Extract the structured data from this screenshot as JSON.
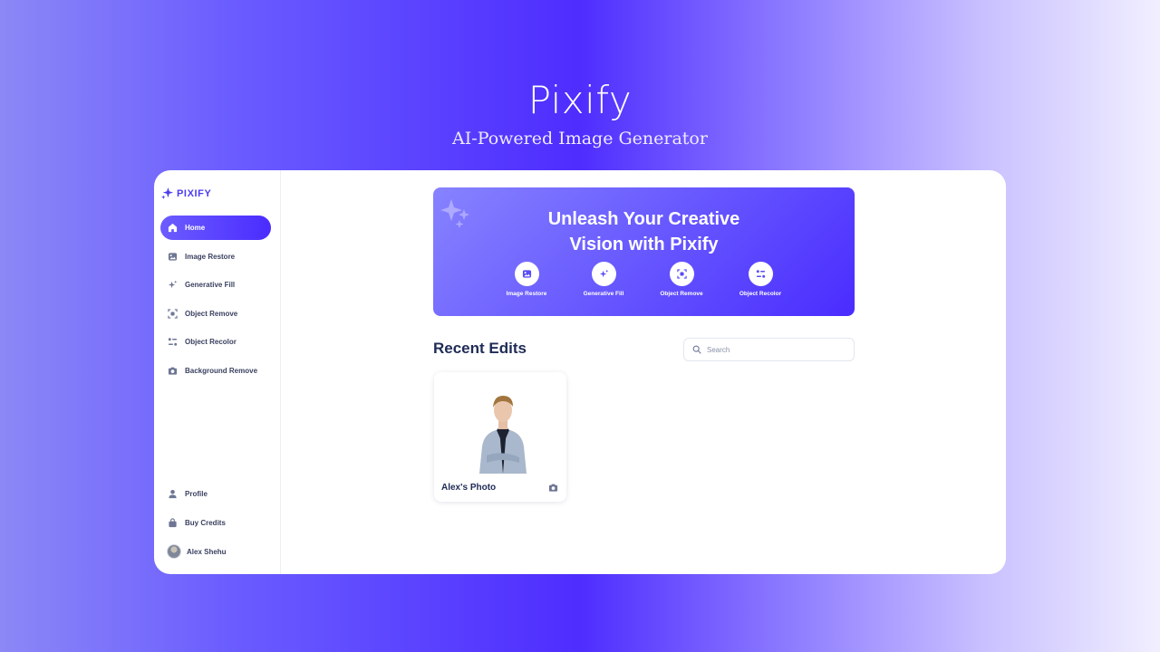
{
  "hero": {
    "title": "Pixify",
    "subtitle": "AI-Powered Image Generator"
  },
  "sidebar": {
    "logo_text": "PIXIFY",
    "items": [
      {
        "label": "Home",
        "icon": "home-icon",
        "active": true
      },
      {
        "label": "Image Restore",
        "icon": "image-icon"
      },
      {
        "label": "Generative Fill",
        "icon": "sparkle-icon"
      },
      {
        "label": "Object Remove",
        "icon": "object-remove-icon"
      },
      {
        "label": "Object Recolor",
        "icon": "recolor-icon"
      },
      {
        "label": "Background Remove",
        "icon": "camera-icon"
      }
    ],
    "bottom_items": [
      {
        "label": "Profile",
        "icon": "user-icon"
      },
      {
        "label": "Buy Credits",
        "icon": "bag-icon"
      }
    ],
    "user_name": "Alex Shehu"
  },
  "banner": {
    "title_line1": "Unleash Your Creative",
    "title_line2": "Vision with Pixify",
    "features": [
      {
        "label": "Image Restore",
        "icon": "image-icon"
      },
      {
        "label": "Generative Fill",
        "icon": "sparkle-icon"
      },
      {
        "label": "Object Remove",
        "icon": "object-remove-icon"
      },
      {
        "label": "Object Recolor",
        "icon": "recolor-icon"
      }
    ]
  },
  "recent": {
    "title": "Recent Edits",
    "search_placeholder": "Search",
    "cards": [
      {
        "label": "Alex's Photo",
        "icon": "camera-icon"
      }
    ]
  },
  "colors": {
    "accent": "#4a2cff",
    "accent_light": "#6c5cff",
    "text_dark": "#1f2b56",
    "text_body": "#3a4160",
    "icon_gray": "#6e7694"
  }
}
